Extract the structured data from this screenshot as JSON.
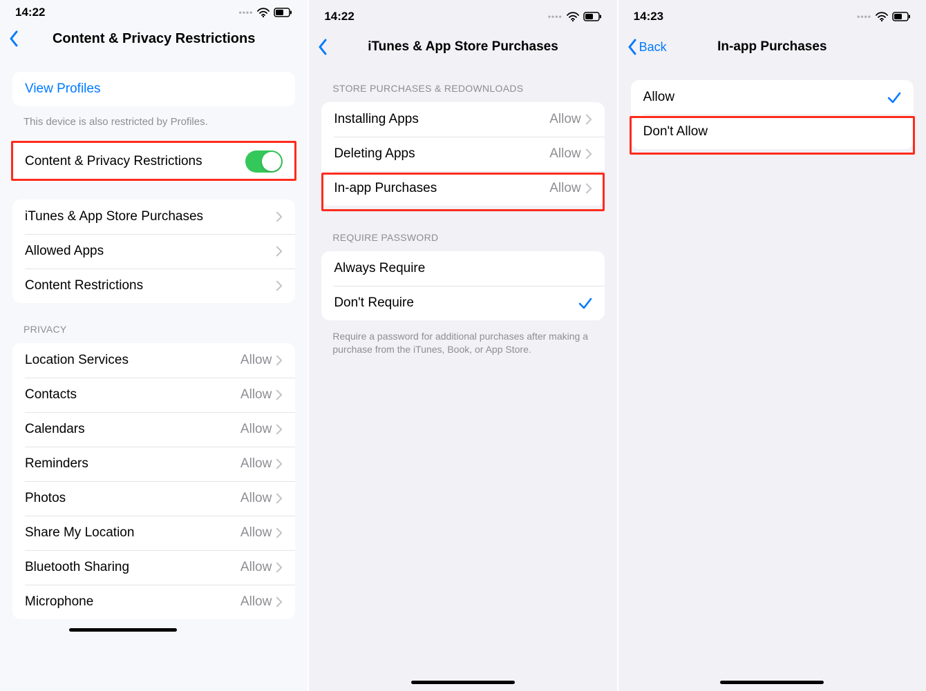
{
  "panel1": {
    "time": "14:22",
    "title": "Content & Privacy Restrictions",
    "viewProfiles": "View Profiles",
    "profilesNote": "This device is also restricted by Profiles.",
    "toggleRow": "Content & Privacy Restrictions",
    "main": [
      {
        "label": "iTunes & App Store Purchases"
      },
      {
        "label": "Allowed Apps"
      },
      {
        "label": "Content Restrictions"
      }
    ],
    "privacyHeader": "PRIVACY",
    "privacy": [
      {
        "label": "Location Services",
        "detail": "Allow"
      },
      {
        "label": "Contacts",
        "detail": "Allow"
      },
      {
        "label": "Calendars",
        "detail": "Allow"
      },
      {
        "label": "Reminders",
        "detail": "Allow"
      },
      {
        "label": "Photos",
        "detail": "Allow"
      },
      {
        "label": "Share My Location",
        "detail": "Allow"
      },
      {
        "label": "Bluetooth Sharing",
        "detail": "Allow"
      },
      {
        "label": "Microphone",
        "detail": "Allow"
      }
    ]
  },
  "panel2": {
    "time": "14:22",
    "title": "iTunes & App Store Purchases",
    "storeHeader": "STORE PURCHASES & REDOWNLOADS",
    "store": [
      {
        "label": "Installing Apps",
        "detail": "Allow"
      },
      {
        "label": "Deleting Apps",
        "detail": "Allow"
      },
      {
        "label": "In-app Purchases",
        "detail": "Allow"
      }
    ],
    "pwHeader": "REQUIRE PASSWORD",
    "pw": [
      {
        "label": "Always Require",
        "checked": false
      },
      {
        "label": "Don't Require",
        "checked": true
      }
    ],
    "pwFooter": "Require a password for additional purchases after making a purchase from the iTunes, Book, or App Store."
  },
  "panel3": {
    "time": "14:23",
    "backLabel": "Back",
    "title": "In-app Purchases",
    "options": [
      {
        "label": "Allow",
        "checked": true
      },
      {
        "label": "Don't Allow",
        "checked": false
      }
    ]
  }
}
